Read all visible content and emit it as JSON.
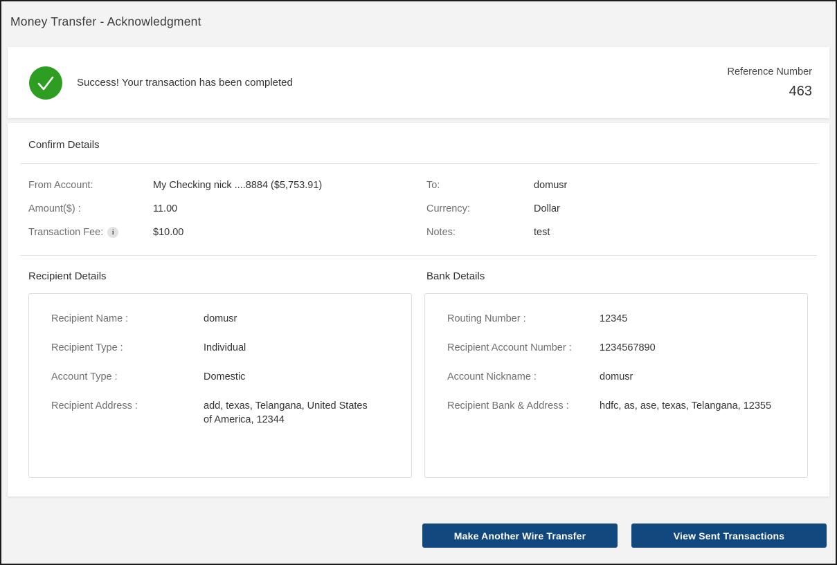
{
  "page": {
    "title": "Money Transfer - Acknowledgment"
  },
  "success_banner": {
    "message": "Success! Your transaction has been completed",
    "reference_label": "Reference Number",
    "reference_value": "463"
  },
  "confirm_details": {
    "heading": "Confirm Details",
    "left": [
      {
        "label": "From Account:",
        "value": "My Checking nick ....8884 ($5,753.91)"
      },
      {
        "label": "Amount($) :",
        "value": "11.00"
      },
      {
        "label": "Transaction Fee:",
        "value": "$10.00"
      }
    ],
    "right": [
      {
        "label": "To:",
        "value": "domusr"
      },
      {
        "label": "Currency:",
        "value": "Dollar"
      },
      {
        "label": "Notes:",
        "value": "test"
      }
    ]
  },
  "recipient_details": {
    "heading": "Recipient Details",
    "rows": [
      {
        "label": "Recipient Name :",
        "value": "domusr"
      },
      {
        "label": "Recipient Type :",
        "value": "Individual"
      },
      {
        "label": "Account Type :",
        "value": "Domestic"
      },
      {
        "label": "Recipient Address :",
        "value": "add, texas, Telangana, United States of America, 12344"
      }
    ]
  },
  "bank_details": {
    "heading": "Bank Details",
    "rows": [
      {
        "label": "Routing Number :",
        "value": "12345"
      },
      {
        "label": "Recipient Account Number :",
        "value": "1234567890"
      },
      {
        "label": "Account Nickname :",
        "value": "domusr"
      },
      {
        "label": "Recipient Bank & Address :",
        "value": "hdfc, as, ase, texas, Telangana, 12355"
      }
    ]
  },
  "actions": {
    "make_another_label": "Make Another Wire Transfer",
    "view_sent_label": "View Sent Transactions"
  },
  "icons": {
    "success_check": "check-icon",
    "transaction_fee_info": "info-icon",
    "info_glyph": "i"
  },
  "colors": {
    "success_green": "#2d9e22",
    "primary_navy": "#11497e",
    "page_background": "#f3f3f3"
  }
}
